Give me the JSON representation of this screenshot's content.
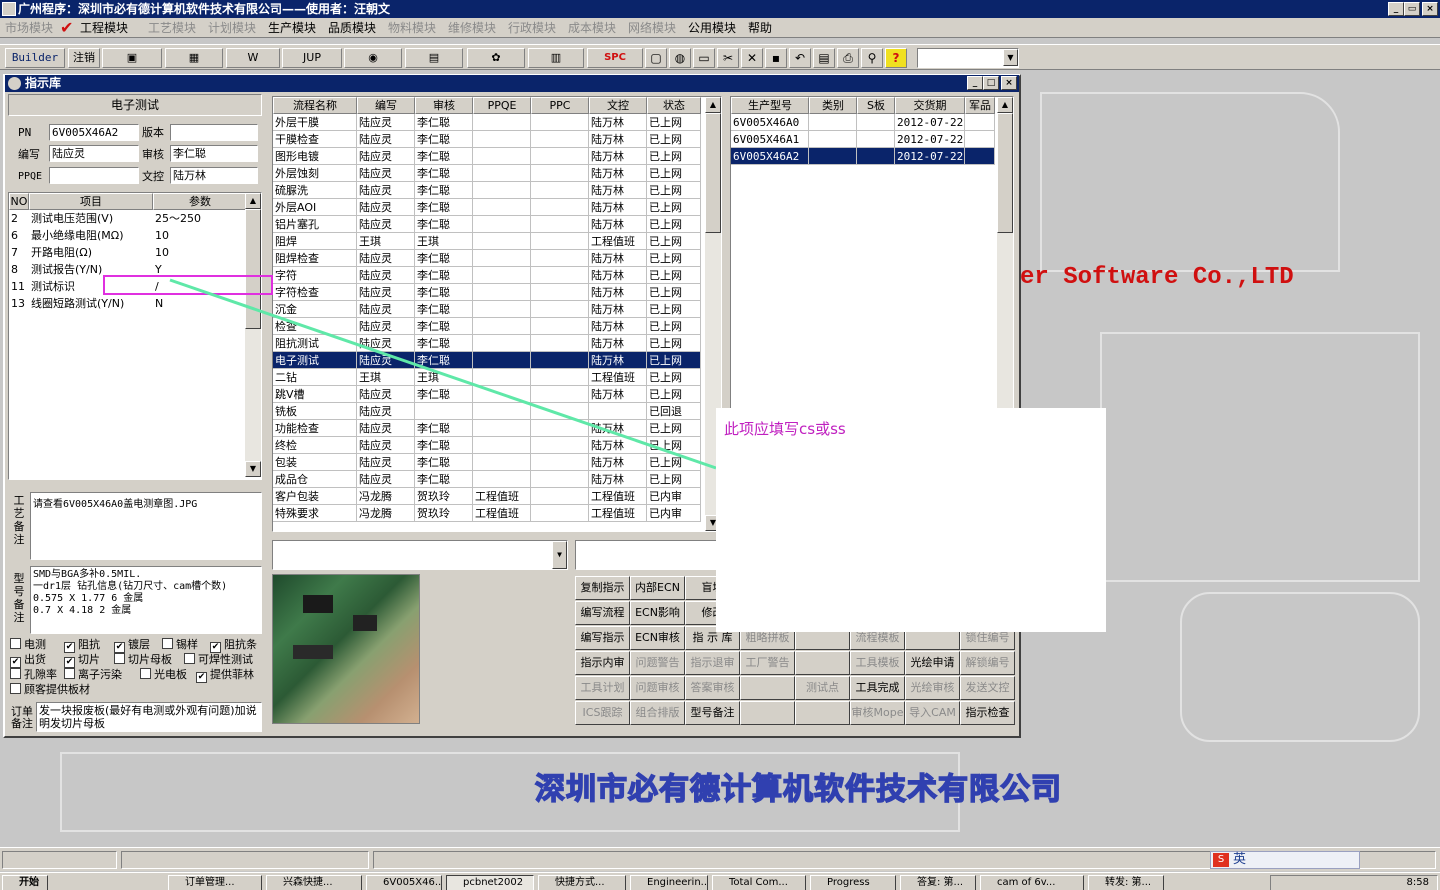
{
  "window": {
    "title": "广州程序：深圳市必有德计算机软件技术有限公司——使用者：汪朝文",
    "buttons": [
      "_",
      "▭",
      "×"
    ]
  },
  "menu": [
    {
      "label": "市场模块",
      "enabled": false
    },
    {
      "label": "工程模块",
      "enabled": true
    },
    {
      "label": "工艺模块",
      "enabled": false
    },
    {
      "label": "计划模块",
      "enabled": false
    },
    {
      "label": "生产模块",
      "enabled": true
    },
    {
      "label": "品质模块",
      "enabled": true
    },
    {
      "label": "物料模块",
      "enabled": false
    },
    {
      "label": "维修模块",
      "enabled": false
    },
    {
      "label": "行政模块",
      "enabled": false
    },
    {
      "label": "成本模块",
      "enabled": false
    },
    {
      "label": "网络模块",
      "enabled": false
    },
    {
      "label": "公用模块",
      "enabled": true
    },
    {
      "label": "帮助",
      "enabled": true
    }
  ],
  "toolbar": {
    "buttons": [
      "Builder",
      "注销",
      "▣",
      "▦",
      "W",
      "JUP",
      "◉",
      "▤",
      "✿",
      "▥",
      "SPC"
    ]
  },
  "background_text": {
    "company_en": "er Software Co.,LTD",
    "company_cn": "深圳市必有德计算机软件技术有限公司"
  },
  "child": {
    "title": "指示库",
    "buttons": [
      "_",
      "□",
      "×"
    ]
  },
  "left": {
    "header": "电子测试",
    "pn_label": "PN",
    "pn_value": "6V005X46A2",
    "version_label": "版本",
    "version_value": "",
    "writer_label": "编写",
    "writer_value": "陆应灵",
    "reviewer_label": "审核",
    "reviewer_value": "李仁聪",
    "ppqe_label": "PPQE",
    "ppqe_value": "",
    "doc_label": "文控",
    "doc_value": "陆万林",
    "param_headers": [
      "NO",
      "项目",
      "参数"
    ],
    "params": [
      [
        "2",
        "测试电压范围(V)",
        "25～250"
      ],
      [
        "6",
        "最小绝缘电阻(MΩ)",
        "10"
      ],
      [
        "7",
        "开路电阻(Ω)",
        "10"
      ],
      [
        "8",
        "测试报告(Y/N)",
        "Y"
      ],
      [
        "11",
        "测试标识",
        "/"
      ],
      [
        "13",
        "线圈短路测试(Y/N)",
        "N"
      ]
    ],
    "craft_label": "工艺备注",
    "craft_text": "请查看6V005X46A0盖电测章图.JPG",
    "model_label": "型号备注",
    "model_text": [
      "SMD与BGA多补0.5MIL.",
      "一dr1层  钻孔信息(钻刀尺寸、cam槽个数)",
      "0.575 X 1.77  6 金属",
      "0.7 X 4.18  2 金属"
    ],
    "checkboxes": [
      {
        "label": "电测",
        "checked": false
      },
      {
        "label": "阻抗",
        "checked": true
      },
      {
        "label": "镀层",
        "checked": true
      },
      {
        "label": "锡样",
        "checked": false
      },
      {
        "label": "阻抗条",
        "checked": true
      },
      {
        "label": "出货",
        "checked": true
      },
      {
        "label": "切片",
        "checked": true
      },
      {
        "label": "切片母板",
        "checked": false
      },
      {
        "label": "可焊性测试",
        "checked": false
      },
      {
        "label": "孔隙率",
        "checked": false
      },
      {
        "label": "离子污染",
        "checked": false
      },
      {
        "label": "光电板",
        "checked": false
      },
      {
        "label": "提供菲林",
        "checked": true
      },
      {
        "label": "顾客提供板材",
        "checked": false
      }
    ],
    "order_label": "订单备注",
    "order_text": "发一块报废板(最好有电测或外观有问题)加说明发切片母板"
  },
  "process_grid": {
    "headers": [
      "流程名称",
      "编写",
      "审核",
      "PPQE",
      "PPC",
      "文控",
      "状态"
    ],
    "rows": [
      [
        "外层干膜",
        "陆应灵",
        "李仁聪",
        "",
        "",
        "陆万林",
        "已上网"
      ],
      [
        "干膜检查",
        "陆应灵",
        "李仁聪",
        "",
        "",
        "陆万林",
        "已上网"
      ],
      [
        "图形电镀",
        "陆应灵",
        "李仁聪",
        "",
        "",
        "陆万林",
        "已上网"
      ],
      [
        "外层蚀刻",
        "陆应灵",
        "李仁聪",
        "",
        "",
        "陆万林",
        "已上网"
      ],
      [
        "硫脲洗",
        "陆应灵",
        "李仁聪",
        "",
        "",
        "陆万林",
        "已上网"
      ],
      [
        "外层AOI",
        "陆应灵",
        "李仁聪",
        "",
        "",
        "陆万林",
        "已上网"
      ],
      [
        "铝片塞孔",
        "陆应灵",
        "李仁聪",
        "",
        "",
        "陆万林",
        "已上网"
      ],
      [
        "阻焊",
        "王琪",
        "王琪",
        "",
        "",
        "工程值班",
        "已上网"
      ],
      [
        "阻焊检查",
        "陆应灵",
        "李仁聪",
        "",
        "",
        "陆万林",
        "已上网"
      ],
      [
        "字符",
        "陆应灵",
        "李仁聪",
        "",
        "",
        "陆万林",
        "已上网"
      ],
      [
        "字符检查",
        "陆应灵",
        "李仁聪",
        "",
        "",
        "陆万林",
        "已上网"
      ],
      [
        "沉金",
        "陆应灵",
        "李仁聪",
        "",
        "",
        "陆万林",
        "已上网"
      ],
      [
        "检查",
        "陆应灵",
        "李仁聪",
        "",
        "",
        "陆万林",
        "已上网"
      ],
      [
        "阻抗测试",
        "陆应灵",
        "李仁聪",
        "",
        "",
        "陆万林",
        "已上网"
      ],
      [
        "电子测试",
        "陆应灵",
        "李仁聪",
        "",
        "",
        "陆万林",
        "已上网"
      ],
      [
        "二钻",
        "王琪",
        "王琪",
        "",
        "",
        "工程值班",
        "已上网"
      ],
      [
        "跳V槽",
        "陆应灵",
        "李仁聪",
        "",
        "",
        "陆万林",
        "已上网"
      ],
      [
        "铣板",
        "陆应灵",
        "",
        "",
        "",
        "",
        "已回退"
      ],
      [
        "功能检查",
        "陆应灵",
        "李仁聪",
        "",
        "",
        "陆万林",
        "已上网"
      ],
      [
        "终检",
        "陆应灵",
        "李仁聪",
        "",
        "",
        "陆万林",
        "已上网"
      ],
      [
        "包装",
        "陆应灵",
        "李仁聪",
        "",
        "",
        "陆万林",
        "已上网"
      ],
      [
        "成品仓",
        "陆应灵",
        "李仁聪",
        "",
        "",
        "陆万林",
        "已上网"
      ],
      [
        "客户包装",
        "冯龙腾",
        "贺玖玲",
        "工程值班",
        "",
        "工程值班",
        "已内审"
      ],
      [
        "特殊要求",
        "冯龙腾",
        "贺玖玲",
        "工程值班",
        "",
        "工程值班",
        "已内审"
      ]
    ],
    "selected_index": 14
  },
  "model_grid": {
    "headers": [
      "生产型号",
      "类别",
      "S板",
      "交货期",
      "军品"
    ],
    "rows": [
      [
        "6V005X46A0",
        "",
        "",
        "2012-07-22",
        ""
      ],
      [
        "6V005X46A1",
        "",
        "",
        "2012-07-22",
        ""
      ],
      [
        "6V005X46A2",
        "",
        "",
        "2012-07-22",
        ""
      ]
    ],
    "selected_index": 2
  },
  "annotation": {
    "text": "此项应填写cs或ss",
    "color": "#c020c0",
    "line_color": "#5fe8a8"
  },
  "actions": [
    [
      {
        "label": "复制指示",
        "en": true
      },
      {
        "label": "内部ECN",
        "en": true
      },
      {
        "label": "盲埋",
        "en": true
      }
    ],
    [
      {
        "label": "编写流程",
        "en": true
      },
      {
        "label": "ECN影响",
        "en": true
      },
      {
        "label": "修改",
        "en": true
      }
    ],
    [
      {
        "label": "编写指示",
        "en": true
      },
      {
        "label": "ECN审核",
        "en": true
      },
      {
        "label": "指 示 库",
        "en": true
      },
      {
        "label": "粗略拼板",
        "en": false
      },
      {
        "label": "",
        "en": false
      },
      {
        "label": "流程模板",
        "en": false
      },
      {
        "label": "",
        "en": false
      },
      {
        "label": "锁住编号",
        "en": false
      }
    ],
    [
      {
        "label": "指示内审",
        "en": true
      },
      {
        "label": "问题警告",
        "en": false
      },
      {
        "label": "指示退审",
        "en": false
      },
      {
        "label": "工厂警告",
        "en": false
      },
      {
        "label": "",
        "en": false
      },
      {
        "label": "工具模板",
        "en": false
      },
      {
        "label": "光绘申请",
        "en": true
      },
      {
        "label": "解锁编号",
        "en": false
      }
    ],
    [
      {
        "label": "工具计划",
        "en": false
      },
      {
        "label": "问题审核",
        "en": false
      },
      {
        "label": "答案审核",
        "en": false
      },
      {
        "label": "",
        "en": false
      },
      {
        "label": "测试点",
        "en": false
      },
      {
        "label": "工具完成",
        "en": true
      },
      {
        "label": "光绘审核",
        "en": false
      },
      {
        "label": "发送文控",
        "en": false
      }
    ],
    [
      {
        "label": "ICS跟踪",
        "en": false
      },
      {
        "label": "组合排版",
        "en": false
      },
      {
        "label": "型号备注",
        "en": true
      },
      {
        "label": "",
        "en": false
      },
      {
        "label": "",
        "en": false
      },
      {
        "label": "审核Mope",
        "en": false
      },
      {
        "label": "导入CAM",
        "en": false
      },
      {
        "label": "指示检查",
        "en": true
      }
    ]
  ],
  "taskbar": {
    "start": "开始",
    "tasks": [
      "订单管理...",
      "兴森快捷...",
      "6V005X46...",
      "pcbnet2002",
      "快捷方式...",
      "Engineerin...",
      "Total Com...",
      "Progress",
      "答复: 第...",
      "cam of 6v...",
      "转发: 第..."
    ],
    "ime": "英",
    "clock": "8:58"
  }
}
